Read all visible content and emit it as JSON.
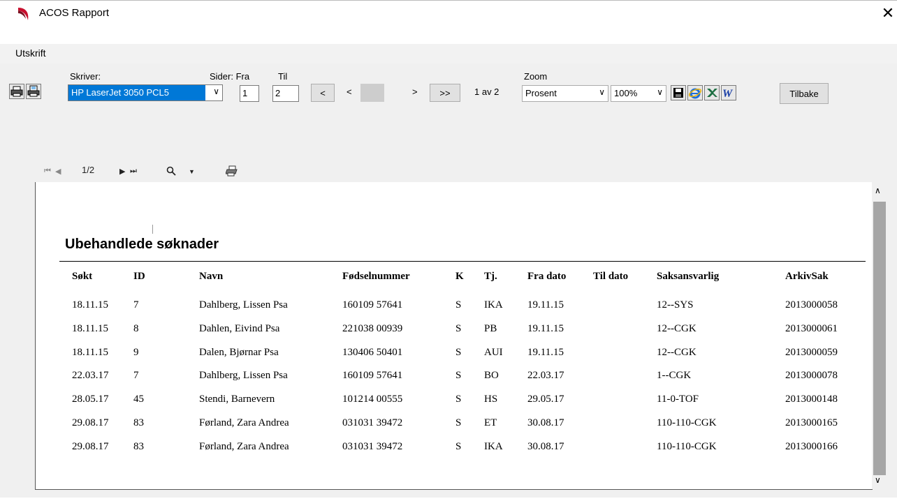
{
  "window": {
    "title": "ACOS Rapport"
  },
  "menu": {
    "items": [
      "Utskrift"
    ]
  },
  "toolbar": {
    "printer_label": "Skriver:",
    "printer_value": "HP LaserJet 3050 PCL5",
    "pages_label": "Sider: Fra",
    "to_label": "Til",
    "from_value": "1",
    "to_value": "2",
    "nav_first": "<",
    "nav_prev": "<",
    "nav_next": ">",
    "nav_last": ">>",
    "page_status": "1 av 2",
    "zoom_label": "Zoom",
    "zoom_mode": "Prosent",
    "zoom_value": "100%",
    "back_button": "Tilbake"
  },
  "viewer": {
    "page_indicator": "1/2"
  },
  "report": {
    "title": "Ubehandlede søknader",
    "columns": [
      "Søkt",
      "ID",
      "Navn",
      "Fødselnummer",
      "K",
      "Tj.",
      "Fra dato",
      "Til dato",
      "Saksansvarlig",
      "ArkivSak"
    ],
    "rows": [
      [
        "18.11.15",
        "7",
        "Dahlberg, Lissen Psa",
        "160109 57641",
        "S",
        "IKA",
        "19.11.15",
        "",
        "12--SYS",
        "2013000058"
      ],
      [
        "18.11.15",
        "8",
        "Dahlen, Eivind Psa",
        "221038 00939",
        "S",
        "PB",
        "19.11.15",
        "",
        "12--CGK",
        "2013000061"
      ],
      [
        "18.11.15",
        "9",
        "Dalen, Bjørnar Psa",
        "130406 50401",
        "S",
        "AUI",
        "19.11.15",
        "",
        "12--CGK",
        "2013000059"
      ],
      [
        "22.03.17",
        "7",
        "Dahlberg, Lissen Psa",
        "160109 57641",
        "S",
        "BO",
        "22.03.17",
        "",
        "1--CGK",
        "2013000078"
      ],
      [
        "28.05.17",
        "45",
        "Stendi, Barnevern",
        "101214 00555",
        "S",
        "HS",
        "29.05.17",
        "",
        "11-0-TOF",
        "2013000148"
      ],
      [
        "29.08.17",
        "83",
        "Førland, Zara Andrea",
        "031031 39472",
        "S",
        "ET",
        "30.08.17",
        "",
        "110-110-CGK",
        "2013000165"
      ],
      [
        "29.08.17",
        "83",
        "Førland, Zara Andrea",
        "031031 39472",
        "S",
        "IKA",
        "30.08.17",
        "",
        "110-110-CGK",
        "2013000166"
      ]
    ]
  },
  "colors": {
    "selection": "#0078d7",
    "logo_red": "#c8102e",
    "scroll_thumb": "#a6a6a6"
  }
}
